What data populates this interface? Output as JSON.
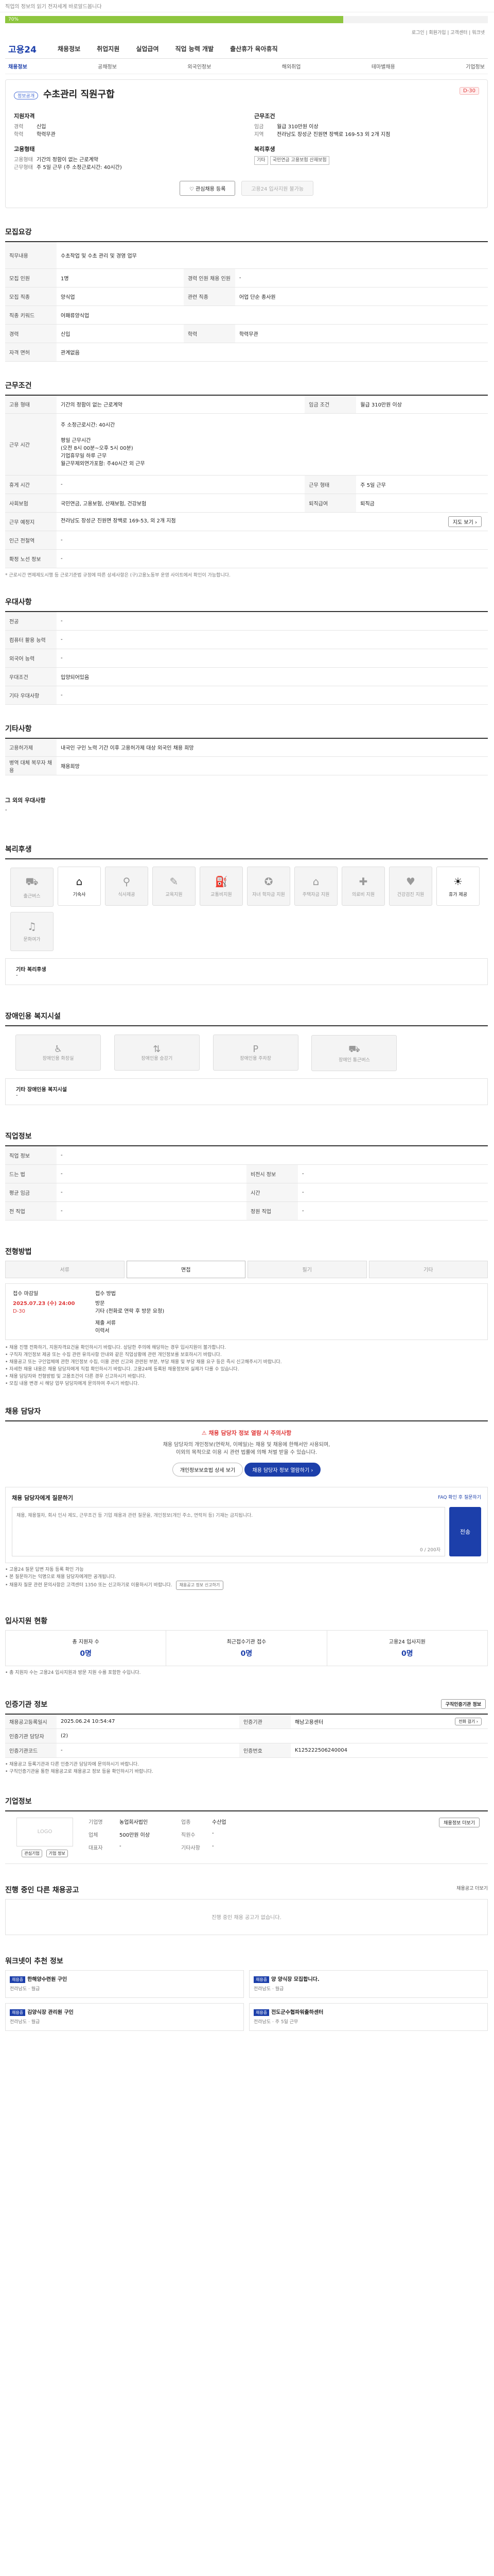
{
  "top": {
    "skip": "직업의 정보의 읽기 전자세계 바로알드봅니다",
    "progress": "70%",
    "progress_value": 0.7,
    "tools": "로그인 | 회원가입 | 고객센터 | 워크넷"
  },
  "gnb": {
    "logo": "고용24",
    "menu": [
      "채용정보",
      "취업지원",
      "실업급여",
      "직업 능력 개발",
      "출산휴가 육아휴직"
    ]
  },
  "lnb": [
    "채용정보",
    "공채정보",
    "외국인정보",
    "해외취업",
    "테마별채용",
    "기업정보"
  ],
  "head": {
    "badge": "정보공개",
    "title": "수초관리 직원구합",
    "dday": "D-30",
    "cols": [
      {
        "h": "지원자격",
        "rows": [
          [
            "경력",
            "신입"
          ],
          [
            "학력",
            "학력무관"
          ]
        ]
      },
      {
        "h": "근무조건",
        "rows": [
          [
            "임금",
            "월급 310만원 이상"
          ],
          [
            "지역",
            "전라남도 장성군 진원면 장백로 169-53 외 2개 지점"
          ]
        ]
      },
      {
        "h": "고용형태",
        "rows": [
          [
            "고용형태",
            "기간의 정함이 없는 근로계약"
          ],
          [
            "근무형태",
            "주 5일 근무 (주 소정근로시간: 40시간)"
          ]
        ]
      },
      {
        "h": "복리후생",
        "rows": [
          [
            "",
            "기타 국민연금 고용보험 산재보험"
          ]
        ],
        "tags": [
          "기타",
          "국민연금 고용보험 산재보험"
        ]
      }
    ],
    "btn1": "관심채용 등록",
    "btn2": "고용24 입사지원 불가능"
  },
  "recruit": {
    "h": "모집요강",
    "duty_k": "직무내용",
    "duty": "수초작업 및 수초 관리 및 경영 업무",
    "rows": [
      [
        "모집 인원",
        "1명",
        "경력 인원 채용 인원",
        "-"
      ],
      [
        "모집 직종",
        "양식업",
        "관련 직종",
        "어업 단순 종사원"
      ],
      [
        "직종 키워드",
        "어패류양식업",
        "",
        ""
      ],
      [
        "경력",
        "신입",
        "학력",
        "학력무관"
      ],
      [
        "자격 면허",
        "관계없음",
        "",
        ""
      ]
    ]
  },
  "work": {
    "h": "근무조건",
    "rows": [
      [
        "고용 형태",
        "기간의 정함이 없는 근로계약",
        "임금 조건",
        "월급 310만원 이상"
      ],
      [
        "근무 시간",
        "주 소정근로시간: 40시간\n\n평일 근무시간\n(오전 8시 00분~오후 5시 00분)\n기업휴무일 하루 근무\n월근무제외연가포함: 주40시간 외 근무",
        "",
        ""
      ],
      [
        "휴게 시간",
        "-",
        "근무 형태",
        "주 5일 근무"
      ],
      [
        "사회보험",
        "국민연금, 고용보험, 산재보험, 건강보험",
        "퇴직급여",
        "퇴직금"
      ],
      [
        "근무 예정지",
        "전라남도 장성군 진원면 장백로 169-53, 외 2개 지점",
        "",
        ""
      ],
      [
        "인근 전철역",
        "-",
        "",
        ""
      ],
      [
        "확정 노선 정보",
        "-",
        "",
        ""
      ]
    ],
    "map_btn": "지도 보기 ›",
    "note": "* 근로시간 면제제도시행 등 근로기준법 규정에 따른 상세사항은 (구)고용노동부 운영 사이트에서 확인이 가능합니다."
  },
  "pref": {
    "h": "우대사항",
    "rows": [
      [
        "전공",
        "-"
      ],
      [
        "컴퓨터 활용 능력",
        "-"
      ],
      [
        "외국어 능력",
        "-"
      ],
      [
        "우대조건",
        "입양되어있음"
      ],
      [
        "기타 우대사항",
        "-"
      ]
    ]
  },
  "etc": {
    "h": "기타사항",
    "rows": [
      [
        "고용허가제",
        "내국인 구인 노력 기간 이후 고용허가제 대상 외국인 채용 희망"
      ],
      [
        "병역 대체 복무자 채용",
        "채용희망"
      ]
    ],
    "sub_h": "그 외의 우대사항",
    "sub_v": "-"
  },
  "welfare": {
    "h": "복리후생",
    "tiles": [
      "출근버스",
      "기숙사",
      "식사제공",
      "교육지원",
      "교통비지원",
      "자녀 학자금 지원",
      "주택자금 지원",
      "의료비 지원",
      "건강검진 지원",
      "휴가 제공",
      "문화여가"
    ],
    "active": [
      1,
      9
    ],
    "etc_h": "기타 복리후생",
    "etc_v": "-"
  },
  "disab": {
    "h": "장애인용 복지시설",
    "tiles": [
      "장애인용 화장실",
      "장애인용 승강기",
      "장애인용 주차장",
      "장애인 통근버스"
    ],
    "etc_h": "기타 장애인용 복지시설",
    "etc_v": "-"
  },
  "org": {
    "h": "직업정보",
    "rows": [
      [
        "직업 정보",
        "-",
        "",
        ""
      ],
      [
        "드는 법",
        "-",
        "비전시 정보",
        "-"
      ],
      [
        "평균 임금",
        "-",
        "시간",
        "-"
      ],
      [
        "전 직업",
        "-",
        "정원 직업",
        "-"
      ]
    ]
  },
  "proc": {
    "h": "전형방법",
    "steps": [
      "서류",
      "면접",
      "필기",
      "기타"
    ],
    "active": 1,
    "deadline_k": "접수 마감일",
    "deadline": "2025.07.23 (수) 24:00",
    "deadline_d": "D-30",
    "method_k": "접수 방법",
    "method": "방문\n기타 (전화로 연락 후 방문 요청)",
    "docs_k": "제출 서류",
    "docs": "이력서",
    "bullets": [
      "• 채용 진행 전화하기, 지원자격요건을 확인하시기 바랍니다. 상담한 주의에 해당하는 경우 입사지원이 불가합니다.",
      "• 구직자 개인정보 제공 또는 수집 관련 유의사항 안내와 같은 직업상황에 관련 개인정보를 보호하시기 바랍니다.",
      "• 채용공고 또는 구인업체에 관한 개인정보 수집, 이용 관련 신고와 관련된 부분, 부당 채용 및 부당 채용 요구 등은 즉시 신고해주시기 바랍니다.",
      "• 자세한 채용 내용은 채용 담당자에게 직접 확인하시기 바랍니다. 고용24에 등록된 채용정보와 실제가 다를 수 있습니다.",
      "• 채용 담당자와 전형방법 및 고용조건이 다른 경우 신고하시기 바랍니다.",
      "• 모집 내용 변경 시 해당 업무 담당자에게 문의하여 주시기 바랍니다."
    ]
  },
  "contact": {
    "h": "채용 담당자",
    "warn": "채용 담당자 정보 열람 시 주의사항",
    "warn_body": "채용 담당자의 개인정보(연락처, 이메일)는 채용 및 채용에 한해서만 사용되며,\n이외의 목적으로 이용 시 관련 법률에 의해 처벌 받을 수 있습니다.",
    "btn1": "개인정보보호법 상세 보기",
    "btn2": "채용 담당자 정보 열람하기 ›",
    "q_h": "채용 담당자에게 질문하기",
    "q_link": "FAQ 확인 후 질문하기",
    "q_ph": "채용, 채용절차, 회사 인사 제도, 근무조건 등 기업 채용과 관련 질문을, 개인정보(개인 주소, 연락처 등) 기재는 금지됩니다.",
    "q_count": "0 / 200자",
    "q_btn": "전송",
    "bullets": [
      "• 고용24 질문 답변 자동 등록 확인 가능",
      "• 본 질문하기는 익명으로 채용 담당자에게만 공개됩니다.",
      "• 채용자 질문 관련 문의사항은 고객센터 1350 또는 신고하기로 이용하시기 바랍니다."
    ],
    "report": "채용공고 정보 신고하기"
  },
  "apply": {
    "h": "입사지원 현황",
    "cells": [
      [
        "총 지원자 수",
        "0명"
      ],
      [
        "최근접수기관 접수",
        "0명"
      ],
      [
        "고용24 입사지원",
        "0명"
      ]
    ],
    "note": "• 총 지원자 수는 고용24 입사지원과 방문 지원 수를 포함한 수입니다."
  },
  "info": {
    "h": "인증기관 정보",
    "copy": "구직인증기관 정보",
    "rows": [
      [
        "채용공고등록일시",
        "2025.06.24 10:54:47",
        "인증기관",
        "해남고용센터"
      ],
      [
        "인증기관 담당자",
        "(2)",
        "",
        ""
      ],
      [
        "인증기관코드",
        "-",
        "인증번호",
        "K125222506240004"
      ]
    ],
    "call": "전화 걸기 ›",
    "bullets": [
      "• 채용공고 등록기관과 다른 인증기관 담당자에 문의하시기 바랍니다.",
      "• 구직인증기관을 통한 채용공고로 채용공고 정보 등을 확인하시기 바랍니다."
    ]
  },
  "company": {
    "h": "기업정보",
    "logo": "LOGO",
    "btns": [
      "관심기업",
      "기업 정보"
    ],
    "rows": [
      [
        "기업명",
        "농업회사법인",
        "업종",
        "수산업"
      ],
      [
        "업체",
        "500만원 이상",
        "직원수",
        "-"
      ],
      [
        "대표자",
        "-",
        "기타사항",
        "-"
      ]
    ],
    "map": "채용정보 더보기"
  },
  "others": {
    "h": "진행 중인 다른 채용공고",
    "more": "채용공고 더보기",
    "empty": "진행 중인 채용 공고가 없습니다."
  },
  "recommend": {
    "h": "워크넷이 추천 정보",
    "items": [
      {
        "lbl": "채용중",
        "title": "한해양수련원 구인",
        "sub": "전라남도 · 월급"
      },
      {
        "lbl": "채용중",
        "title": "양 양식장 모집합니다.",
        "sub": "전라남도 · 월급"
      },
      {
        "lbl": "채용중",
        "title": "김양식장 관리원 구인",
        "sub": "전라남도 · 월급"
      },
      {
        "lbl": "채용중",
        "title": "전도군수협파워출하센터",
        "sub": "전라남도 · 주 5일 근무"
      }
    ]
  }
}
